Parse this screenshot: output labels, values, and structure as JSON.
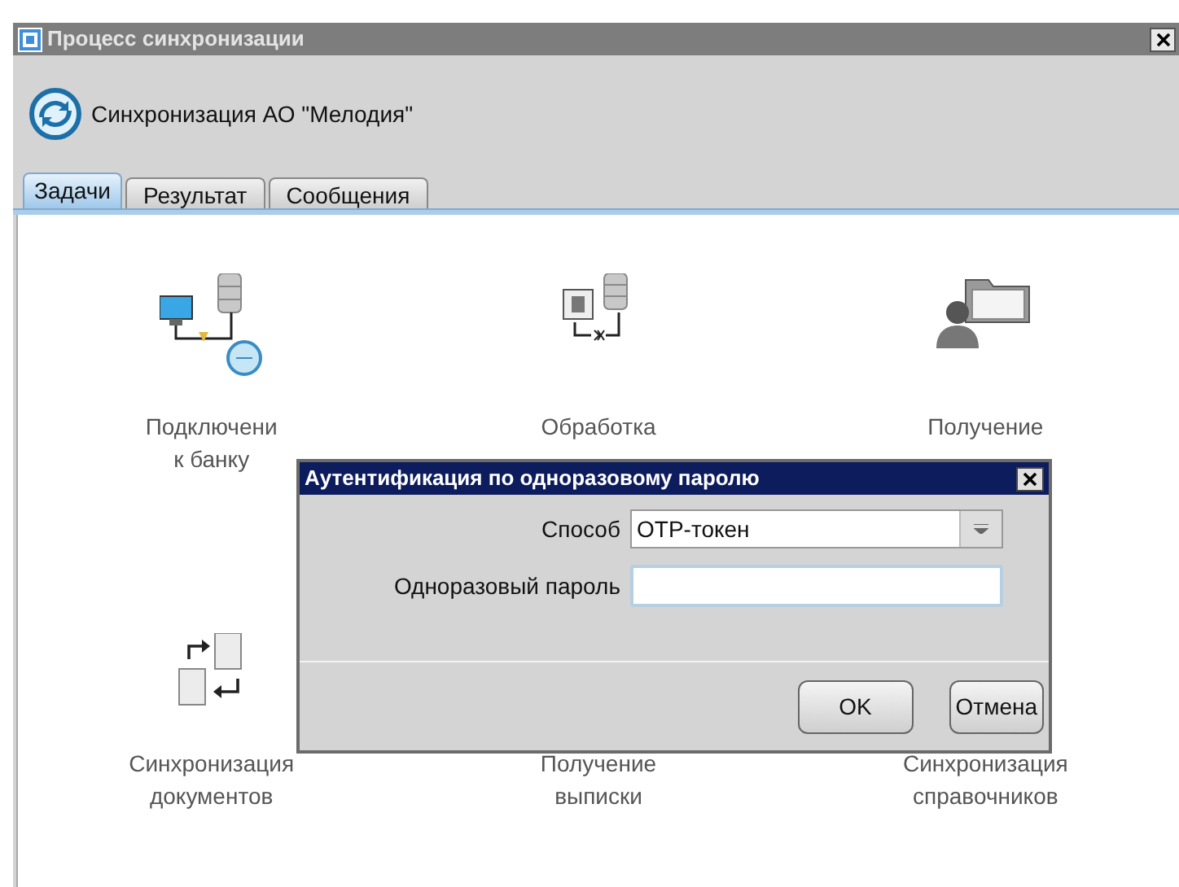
{
  "window": {
    "title": "Процесс синхронизации"
  },
  "header": {
    "title": "Синхронизация АО \"Мелодия\""
  },
  "tabs": [
    {
      "label": "Задачи",
      "selected": true
    },
    {
      "label": "Результат",
      "selected": false
    },
    {
      "label": "Сообщения",
      "selected": false
    }
  ],
  "tasks": [
    {
      "kind": "connect",
      "lines": [
        "Подключени",
        "к банку"
      ]
    },
    {
      "kind": "process",
      "lines": [
        "Обработка"
      ]
    },
    {
      "kind": "receive",
      "lines": [
        "Получение"
      ]
    },
    {
      "kind": "docs",
      "lines": [
        "Синхронизация",
        "документов"
      ]
    },
    {
      "kind": "statement",
      "lines": [
        "Получение",
        "выписки"
      ]
    },
    {
      "kind": "refs",
      "lines": [
        "Синхронизация",
        "справочников"
      ]
    }
  ],
  "dialog": {
    "title": "Аутентификация по одноразовому паролю",
    "fields": [
      {
        "kind": "select",
        "label": "Способ",
        "value": "OTP-токен"
      },
      {
        "kind": "input",
        "label": "Одноразовый пароль"
      }
    ],
    "buttons": [
      "OK",
      "Отмена"
    ]
  }
}
